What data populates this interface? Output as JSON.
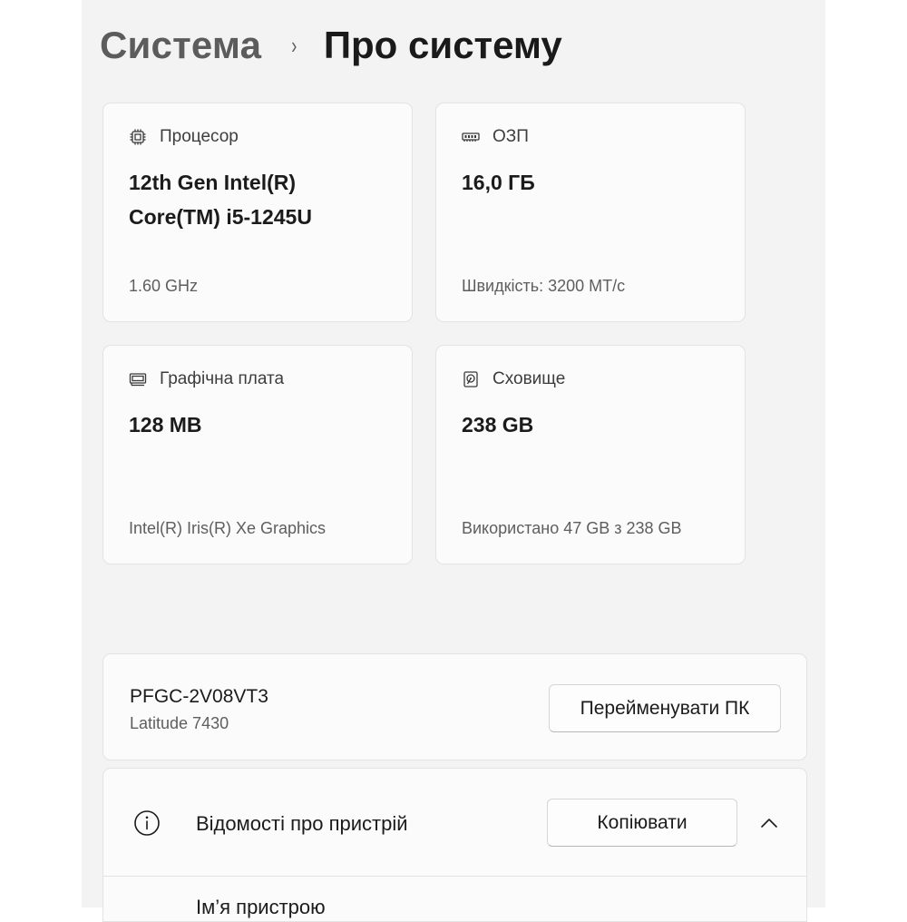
{
  "breadcrumb": {
    "parent": "Система",
    "separator": "›",
    "current": "Про систему"
  },
  "specs": {
    "processor": {
      "icon": "processor-chip-icon",
      "label": "Процесор",
      "value_line1": "12th Gen Intel(R)",
      "value_line2": "Core(TM) i5-1245U",
      "detail": "1.60 GHz"
    },
    "ram": {
      "icon": "ram-memory-icon",
      "label": "ОЗП",
      "value": "16,0 ГБ",
      "detail": "Швидкість: 3200 МТ/с"
    },
    "graphics": {
      "icon": "graphics-card-icon",
      "label": "Графічна плата",
      "value": "128 MB",
      "detail": "Intel(R) Iris(R) Xe Graphics"
    },
    "storage": {
      "icon": "storage-drive-icon",
      "label": "Сховище",
      "value": "238 GB",
      "detail": "Використано 47 GB з 238 GB"
    }
  },
  "pc": {
    "name": "PFGC-2V08VT3",
    "model": "Latitude 7430",
    "rename_label": "Перейменувати ПК"
  },
  "device_info": {
    "icon": "info-circle-icon",
    "title": "Відомості про пристрій",
    "copy_label": "Копіювати",
    "first_row_label": "Ім’я пристрою"
  }
}
